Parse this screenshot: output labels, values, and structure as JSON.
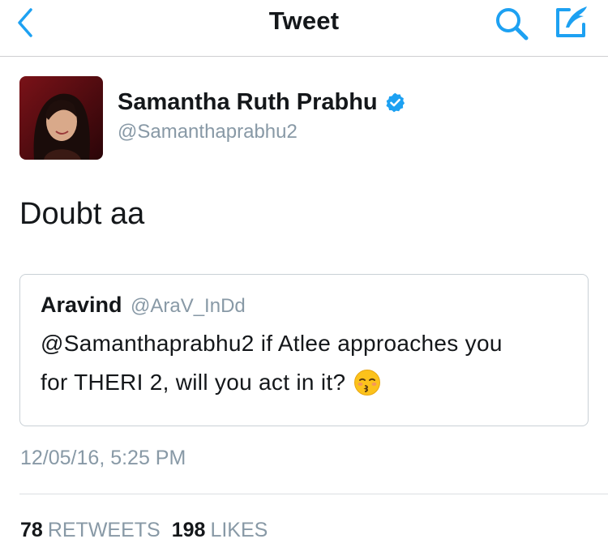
{
  "header": {
    "title": "Tweet"
  },
  "tweet": {
    "author_name": "Samantha Ruth Prabhu",
    "author_handle": "@Samanthaprabhu2",
    "text": "Doubt aa",
    "timestamp": "12/05/16, 5:25 PM",
    "retweets_count": "78",
    "retweets_label": "RETWEETS",
    "likes_count": "198",
    "likes_label": "LIKES"
  },
  "quoted_tweet": {
    "author_name": "Aravind",
    "author_handle": "@AraV_InDd",
    "text_line1": "@Samanthaprabhu2 if Atlee approaches you",
    "text_line2": "for THERI 2, will you act in it?",
    "emoji": "kissing-face-closed-eyes-icon"
  },
  "colors": {
    "accent": "#1da1f2",
    "text_primary": "#14171a",
    "text_secondary": "#8899a6",
    "divider": "#dcdfe2"
  },
  "icons": {
    "back": "chevron-left-icon",
    "search": "search-icon",
    "compose": "compose-icon",
    "verified": "verified-badge-icon"
  }
}
